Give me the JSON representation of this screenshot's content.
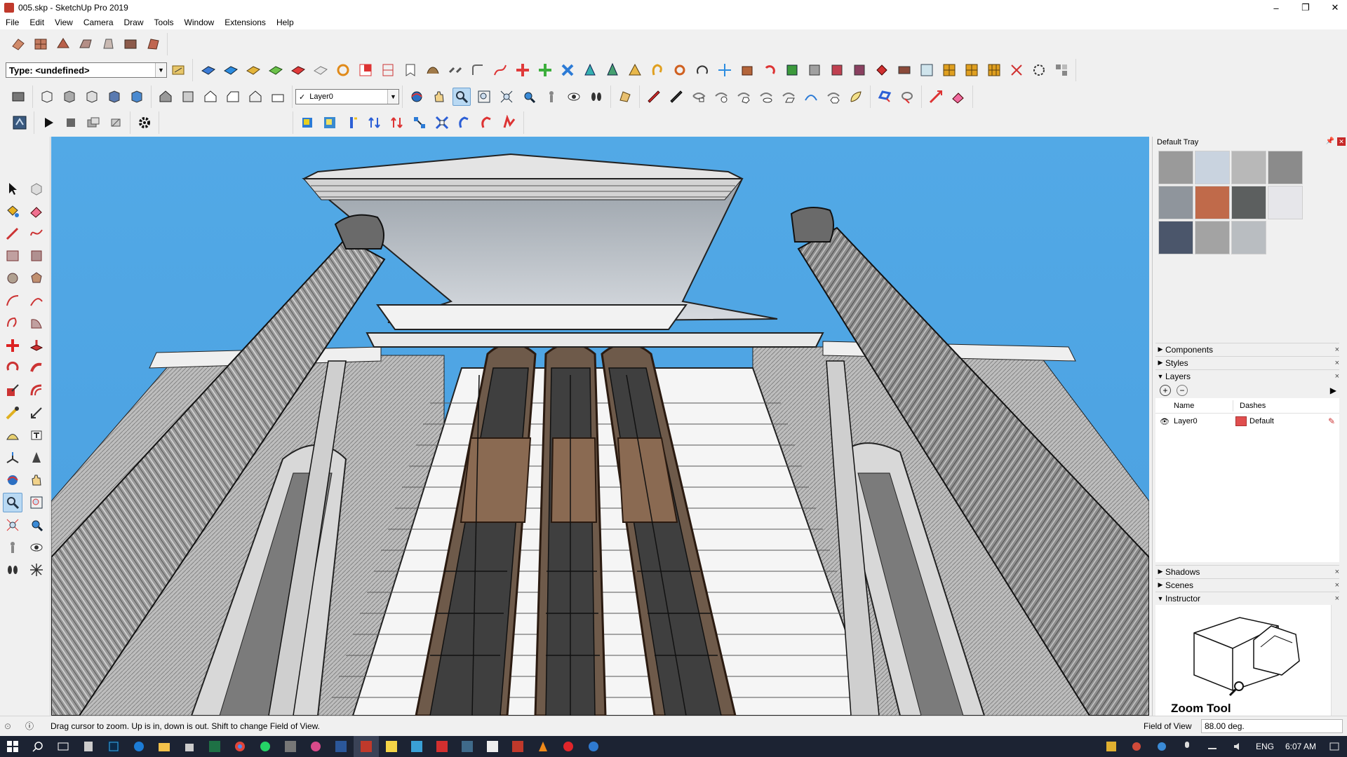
{
  "window": {
    "title": "005.skp - SketchUp Pro 2019",
    "minimize": "–",
    "maximize": "❐",
    "close": "✕"
  },
  "menu": [
    "File",
    "Edit",
    "View",
    "Camera",
    "Draw",
    "Tools",
    "Window",
    "Extensions",
    "Help"
  ],
  "toolbar": {
    "type_combo": "Type: <undefined>",
    "layer_combo": "Layer0"
  },
  "tray": {
    "title": "Default Tray",
    "swatch_colors": [
      "#9a9a9a",
      "#c9d3df",
      "#b8b8b8",
      "#8b8b8b",
      "#8f959c",
      "#c06a4a",
      "#5c5f5f",
      "#e6e6ea",
      "#4b566b",
      "#a3a3a3",
      "#b9bdc1"
    ],
    "panels": {
      "components": "Components",
      "styles": "Styles",
      "layers": "Layers",
      "shadows": "Shadows",
      "scenes": "Scenes",
      "instructor": "Instructor"
    },
    "layers": {
      "col_name": "Name",
      "col_dashes": "Dashes",
      "row_name": "Layer0",
      "row_dashes": "Default",
      "row_color": "#e04e4e"
    },
    "instructor_title": "Zoom Tool"
  },
  "status": {
    "message": "Drag cursor to zoom.  Up is in, down is out. Shift to change Field of View.",
    "fov_label": "Field of View",
    "fov_value": "88.00 deg."
  },
  "taskbar": {
    "lang": "ENG",
    "time": "6:07 AM"
  },
  "colors": {
    "sky": "#4fa6e4",
    "accent_red": "#c62828"
  }
}
